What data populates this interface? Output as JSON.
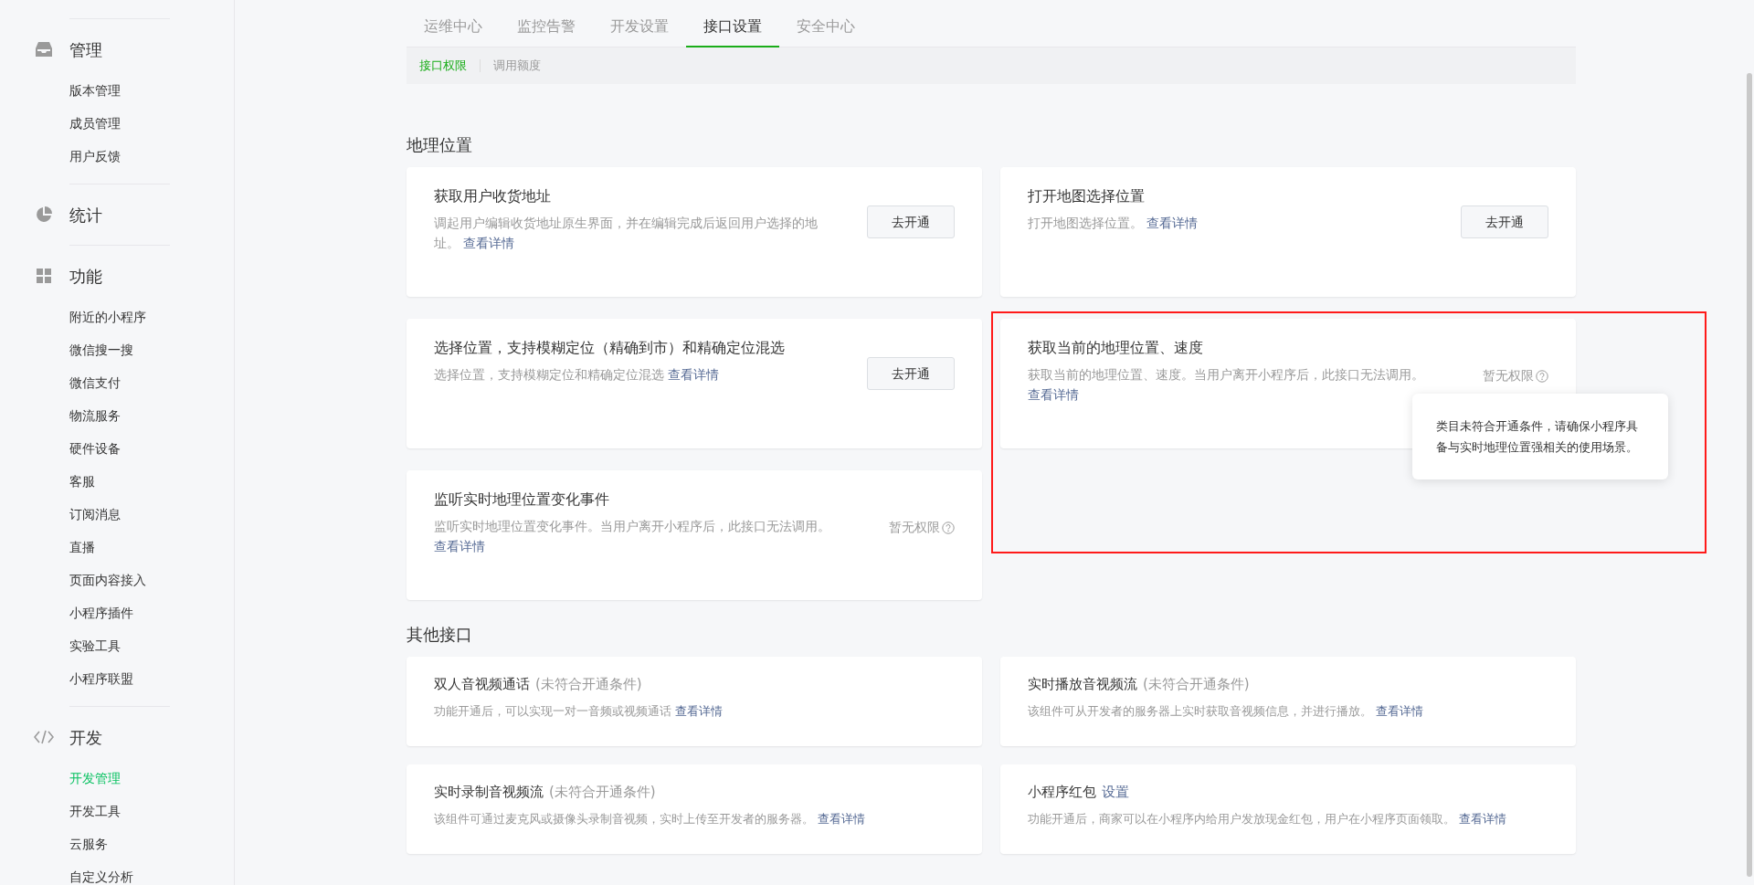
{
  "sidebar": {
    "groups": [
      {
        "title": "管理",
        "items": [
          {
            "label": "版本管理",
            "selected": false
          },
          {
            "label": "成员管理",
            "selected": false
          },
          {
            "label": "用户反馈",
            "selected": false
          }
        ]
      },
      {
        "title": "统计"
      },
      {
        "title": "功能",
        "items": [
          {
            "label": "附近的小程序",
            "selected": false
          },
          {
            "label": "微信搜一搜",
            "selected": false
          },
          {
            "label": "微信支付",
            "selected": false
          },
          {
            "label": "物流服务",
            "selected": false
          },
          {
            "label": "硬件设备",
            "selected": false
          },
          {
            "label": "客服",
            "selected": false
          },
          {
            "label": "订阅消息",
            "selected": false
          },
          {
            "label": "直播",
            "selected": false
          },
          {
            "label": "页面内容接入",
            "selected": false
          },
          {
            "label": "小程序插件",
            "selected": false
          },
          {
            "label": "实验工具",
            "selected": false
          },
          {
            "label": "小程序联盟",
            "selected": false
          }
        ]
      },
      {
        "title": "开发",
        "items": [
          {
            "label": "开发管理",
            "selected": true
          },
          {
            "label": "开发工具",
            "selected": false
          },
          {
            "label": "云服务",
            "selected": false
          },
          {
            "label": "自定义分析",
            "selected": false
          }
        ]
      }
    ]
  },
  "tabs": [
    {
      "label": "运维中心",
      "selected": false
    },
    {
      "label": "监控告警",
      "selected": false
    },
    {
      "label": "开发设置",
      "selected": false
    },
    {
      "label": "接口设置",
      "selected": true
    },
    {
      "label": "安全中心",
      "selected": false
    }
  ],
  "subtabs": [
    {
      "label": "接口权限",
      "selected": true
    },
    {
      "label": "调用额度",
      "selected": false
    }
  ],
  "sections": [
    {
      "title": "地理位置",
      "cards": [
        {
          "title": "获取用户收货地址",
          "description": "调起用户编辑收货地址原生界面，并在编辑完成后返回用户选择的地址。",
          "link": "查看详情",
          "action": {
            "kind": "button",
            "label": "去开通"
          }
        },
        {
          "title": "打开地图选择位置",
          "description": "打开地图选择位置。",
          "link": "查看详情",
          "action": {
            "kind": "button",
            "label": "去开通"
          }
        },
        {
          "title": "选择位置，支持模糊定位（精确到市）和精确定位混选",
          "description": "选择位置，支持模糊定位和精确定位混选",
          "link": "查看详情",
          "action": {
            "kind": "button",
            "label": "去开通"
          }
        },
        {
          "title": "获取当前的地理位置、速度",
          "description": "获取当前的地理位置、速度。当用户离开小程序后，此接口无法调用。",
          "link": "查看详情",
          "action": {
            "kind": "no_permission",
            "label": "暂无权限",
            "tooltip": "类目未符合开通条件，请确保小程序具备与实时地理位置强相关的使用场景。"
          },
          "highlighted": true
        },
        {
          "title": "监听实时地理位置变化事件",
          "description": "监听实时地理位置变化事件。当用户离开小程序后，此接口无法调用。",
          "link": "查看详情",
          "action": {
            "kind": "no_permission",
            "label": "暂无权限"
          }
        }
      ]
    },
    {
      "title": "其他接口",
      "cards": [
        {
          "title": "双人音视频通话",
          "status": "(未符合开通条件)",
          "description": "功能开通后，可以实现一对一音频或视频通话",
          "link": "查看详情"
        },
        {
          "title": "实时播放音视频流",
          "status": "(未符合开通条件)",
          "description": "该组件可从开发者的服务器上实时获取音视频信息，并进行播放。",
          "link": "查看详情"
        },
        {
          "title": "实时录制音视频流",
          "status": "(未符合开通条件)",
          "description": "该组件可通过麦克风或摄像头录制音视频，实时上传至开发者的服务器。",
          "link": "查看详情"
        },
        {
          "title": "小程序红包",
          "title_link": "设置",
          "description": "功能开通后，商家可以在小程序内给用户发放现金红包，用户在小程序页面领取。",
          "link": "查看详情"
        }
      ]
    }
  ]
}
